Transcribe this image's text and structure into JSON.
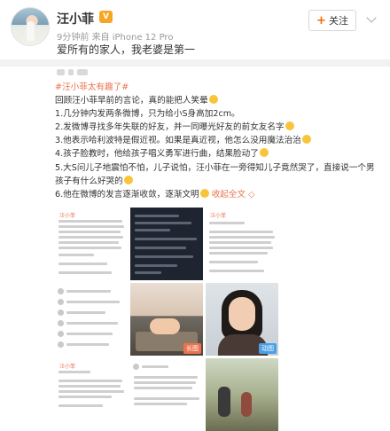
{
  "header": {
    "username": "汪小菲",
    "vip_badge": "V",
    "time": "9分钟前",
    "source": "来自 iPhone 12 Pro",
    "follow_label": "关注",
    "bio": "爱所有的家人，我老婆是第一"
  },
  "post": {
    "hashtag": "#汪小菲太有趣了#",
    "lines": [
      "回顾汪小菲早前的言论，真的能把人笑晕",
      "1.几分钟内发两条微博，只为给小S身高加2cm。",
      "2.发微博寻找多年失联的好友，并一同曝光好友的前女友名字",
      "3.他表示哈利波特是假近视。如果是真近视，他怎么没用魔法治治",
      "4.孩子脸教时，他给孩子唱义勇军进行曲，结果脸动了",
      "5.大S问儿子地震怕不怕，儿子说怕，汪小菲在一旁得知儿子竟然哭了，直接说一个男孩子有什么好哭的",
      "6.他在微博的发言逐渐收敛，逐渐文明"
    ],
    "expand_label": "收起全文",
    "expand_arrow": "◇"
  },
  "images": [
    {
      "name": "weibo-screenshot-1",
      "label": "汪小菲"
    },
    {
      "name": "dark-screenshot",
      "label": ""
    },
    {
      "name": "weibo-screenshot-2",
      "label": "汪小菲"
    },
    {
      "name": "comment-screenshot",
      "label": ""
    },
    {
      "name": "child-on-bed-photo",
      "label": "",
      "badge": "长图"
    },
    {
      "name": "woman-portrait-photo",
      "label": "",
      "badge": "动图"
    },
    {
      "name": "weibo-screenshot-3",
      "label": "汪小菲"
    },
    {
      "name": "weibo-screenshot-4",
      "label": ""
    },
    {
      "name": "outdoor-photo",
      "label": ""
    }
  ],
  "colors": {
    "accent": "#eb7350",
    "vip": "#f6a623",
    "gif": "#4aa0e6"
  }
}
